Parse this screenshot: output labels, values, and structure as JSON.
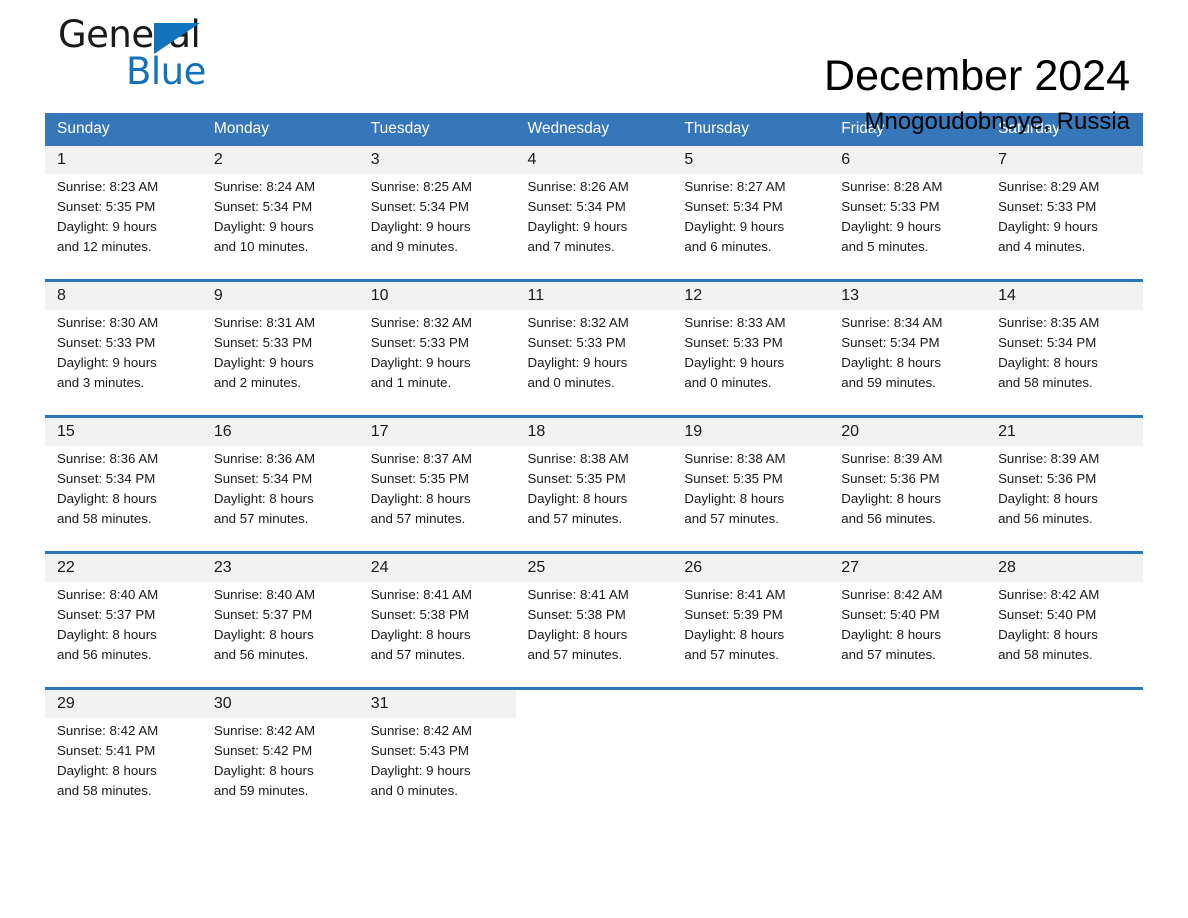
{
  "brand": {
    "name_part1": "General",
    "name_part2": "Blue",
    "accent_color": "#1272bb",
    "triangle_icon": "triangle-icon"
  },
  "header": {
    "title": "December 2024",
    "location": "Mnogoudobnoye, Russia"
  },
  "theme": {
    "header_blue": "#3577b9",
    "rule_blue": "#2e75b6",
    "daynum_bg": "#f2f2f2"
  },
  "weekdays": [
    "Sunday",
    "Monday",
    "Tuesday",
    "Wednesday",
    "Thursday",
    "Friday",
    "Saturday"
  ],
  "weeks": [
    [
      {
        "day": "1",
        "sunrise": "Sunrise: 8:23 AM",
        "sunset": "Sunset: 5:35 PM",
        "daylight_l1": "Daylight: 9 hours",
        "daylight_l2": "and 12 minutes."
      },
      {
        "day": "2",
        "sunrise": "Sunrise: 8:24 AM",
        "sunset": "Sunset: 5:34 PM",
        "daylight_l1": "Daylight: 9 hours",
        "daylight_l2": "and 10 minutes."
      },
      {
        "day": "3",
        "sunrise": "Sunrise: 8:25 AM",
        "sunset": "Sunset: 5:34 PM",
        "daylight_l1": "Daylight: 9 hours",
        "daylight_l2": "and 9 minutes."
      },
      {
        "day": "4",
        "sunrise": "Sunrise: 8:26 AM",
        "sunset": "Sunset: 5:34 PM",
        "daylight_l1": "Daylight: 9 hours",
        "daylight_l2": "and 7 minutes."
      },
      {
        "day": "5",
        "sunrise": "Sunrise: 8:27 AM",
        "sunset": "Sunset: 5:34 PM",
        "daylight_l1": "Daylight: 9 hours",
        "daylight_l2": "and 6 minutes."
      },
      {
        "day": "6",
        "sunrise": "Sunrise: 8:28 AM",
        "sunset": "Sunset: 5:33 PM",
        "daylight_l1": "Daylight: 9 hours",
        "daylight_l2": "and 5 minutes."
      },
      {
        "day": "7",
        "sunrise": "Sunrise: 8:29 AM",
        "sunset": "Sunset: 5:33 PM",
        "daylight_l1": "Daylight: 9 hours",
        "daylight_l2": "and 4 minutes."
      }
    ],
    [
      {
        "day": "8",
        "sunrise": "Sunrise: 8:30 AM",
        "sunset": "Sunset: 5:33 PM",
        "daylight_l1": "Daylight: 9 hours",
        "daylight_l2": "and 3 minutes."
      },
      {
        "day": "9",
        "sunrise": "Sunrise: 8:31 AM",
        "sunset": "Sunset: 5:33 PM",
        "daylight_l1": "Daylight: 9 hours",
        "daylight_l2": "and 2 minutes."
      },
      {
        "day": "10",
        "sunrise": "Sunrise: 8:32 AM",
        "sunset": "Sunset: 5:33 PM",
        "daylight_l1": "Daylight: 9 hours",
        "daylight_l2": "and 1 minute."
      },
      {
        "day": "11",
        "sunrise": "Sunrise: 8:32 AM",
        "sunset": "Sunset: 5:33 PM",
        "daylight_l1": "Daylight: 9 hours",
        "daylight_l2": "and 0 minutes."
      },
      {
        "day": "12",
        "sunrise": "Sunrise: 8:33 AM",
        "sunset": "Sunset: 5:33 PM",
        "daylight_l1": "Daylight: 9 hours",
        "daylight_l2": "and 0 minutes."
      },
      {
        "day": "13",
        "sunrise": "Sunrise: 8:34 AM",
        "sunset": "Sunset: 5:34 PM",
        "daylight_l1": "Daylight: 8 hours",
        "daylight_l2": "and 59 minutes."
      },
      {
        "day": "14",
        "sunrise": "Sunrise: 8:35 AM",
        "sunset": "Sunset: 5:34 PM",
        "daylight_l1": "Daylight: 8 hours",
        "daylight_l2": "and 58 minutes."
      }
    ],
    [
      {
        "day": "15",
        "sunrise": "Sunrise: 8:36 AM",
        "sunset": "Sunset: 5:34 PM",
        "daylight_l1": "Daylight: 8 hours",
        "daylight_l2": "and 58 minutes."
      },
      {
        "day": "16",
        "sunrise": "Sunrise: 8:36 AM",
        "sunset": "Sunset: 5:34 PM",
        "daylight_l1": "Daylight: 8 hours",
        "daylight_l2": "and 57 minutes."
      },
      {
        "day": "17",
        "sunrise": "Sunrise: 8:37 AM",
        "sunset": "Sunset: 5:35 PM",
        "daylight_l1": "Daylight: 8 hours",
        "daylight_l2": "and 57 minutes."
      },
      {
        "day": "18",
        "sunrise": "Sunrise: 8:38 AM",
        "sunset": "Sunset: 5:35 PM",
        "daylight_l1": "Daylight: 8 hours",
        "daylight_l2": "and 57 minutes."
      },
      {
        "day": "19",
        "sunrise": "Sunrise: 8:38 AM",
        "sunset": "Sunset: 5:35 PM",
        "daylight_l1": "Daylight: 8 hours",
        "daylight_l2": "and 57 minutes."
      },
      {
        "day": "20",
        "sunrise": "Sunrise: 8:39 AM",
        "sunset": "Sunset: 5:36 PM",
        "daylight_l1": "Daylight: 8 hours",
        "daylight_l2": "and 56 minutes."
      },
      {
        "day": "21",
        "sunrise": "Sunrise: 8:39 AM",
        "sunset": "Sunset: 5:36 PM",
        "daylight_l1": "Daylight: 8 hours",
        "daylight_l2": "and 56 minutes."
      }
    ],
    [
      {
        "day": "22",
        "sunrise": "Sunrise: 8:40 AM",
        "sunset": "Sunset: 5:37 PM",
        "daylight_l1": "Daylight: 8 hours",
        "daylight_l2": "and 56 minutes."
      },
      {
        "day": "23",
        "sunrise": "Sunrise: 8:40 AM",
        "sunset": "Sunset: 5:37 PM",
        "daylight_l1": "Daylight: 8 hours",
        "daylight_l2": "and 56 minutes."
      },
      {
        "day": "24",
        "sunrise": "Sunrise: 8:41 AM",
        "sunset": "Sunset: 5:38 PM",
        "daylight_l1": "Daylight: 8 hours",
        "daylight_l2": "and 57 minutes."
      },
      {
        "day": "25",
        "sunrise": "Sunrise: 8:41 AM",
        "sunset": "Sunset: 5:38 PM",
        "daylight_l1": "Daylight: 8 hours",
        "daylight_l2": "and 57 minutes."
      },
      {
        "day": "26",
        "sunrise": "Sunrise: 8:41 AM",
        "sunset": "Sunset: 5:39 PM",
        "daylight_l1": "Daylight: 8 hours",
        "daylight_l2": "and 57 minutes."
      },
      {
        "day": "27",
        "sunrise": "Sunrise: 8:42 AM",
        "sunset": "Sunset: 5:40 PM",
        "daylight_l1": "Daylight: 8 hours",
        "daylight_l2": "and 57 minutes."
      },
      {
        "day": "28",
        "sunrise": "Sunrise: 8:42 AM",
        "sunset": "Sunset: 5:40 PM",
        "daylight_l1": "Daylight: 8 hours",
        "daylight_l2": "and 58 minutes."
      }
    ],
    [
      {
        "day": "29",
        "sunrise": "Sunrise: 8:42 AM",
        "sunset": "Sunset: 5:41 PM",
        "daylight_l1": "Daylight: 8 hours",
        "daylight_l2": "and 58 minutes."
      },
      {
        "day": "30",
        "sunrise": "Sunrise: 8:42 AM",
        "sunset": "Sunset: 5:42 PM",
        "daylight_l1": "Daylight: 8 hours",
        "daylight_l2": "and 59 minutes."
      },
      {
        "day": "31",
        "sunrise": "Sunrise: 8:42 AM",
        "sunset": "Sunset: 5:43 PM",
        "daylight_l1": "Daylight: 9 hours",
        "daylight_l2": "and 0 minutes."
      },
      {
        "day": "",
        "sunrise": "",
        "sunset": "",
        "daylight_l1": "",
        "daylight_l2": ""
      },
      {
        "day": "",
        "sunrise": "",
        "sunset": "",
        "daylight_l1": "",
        "daylight_l2": ""
      },
      {
        "day": "",
        "sunrise": "",
        "sunset": "",
        "daylight_l1": "",
        "daylight_l2": ""
      },
      {
        "day": "",
        "sunrise": "",
        "sunset": "",
        "daylight_l1": "",
        "daylight_l2": ""
      }
    ]
  ]
}
